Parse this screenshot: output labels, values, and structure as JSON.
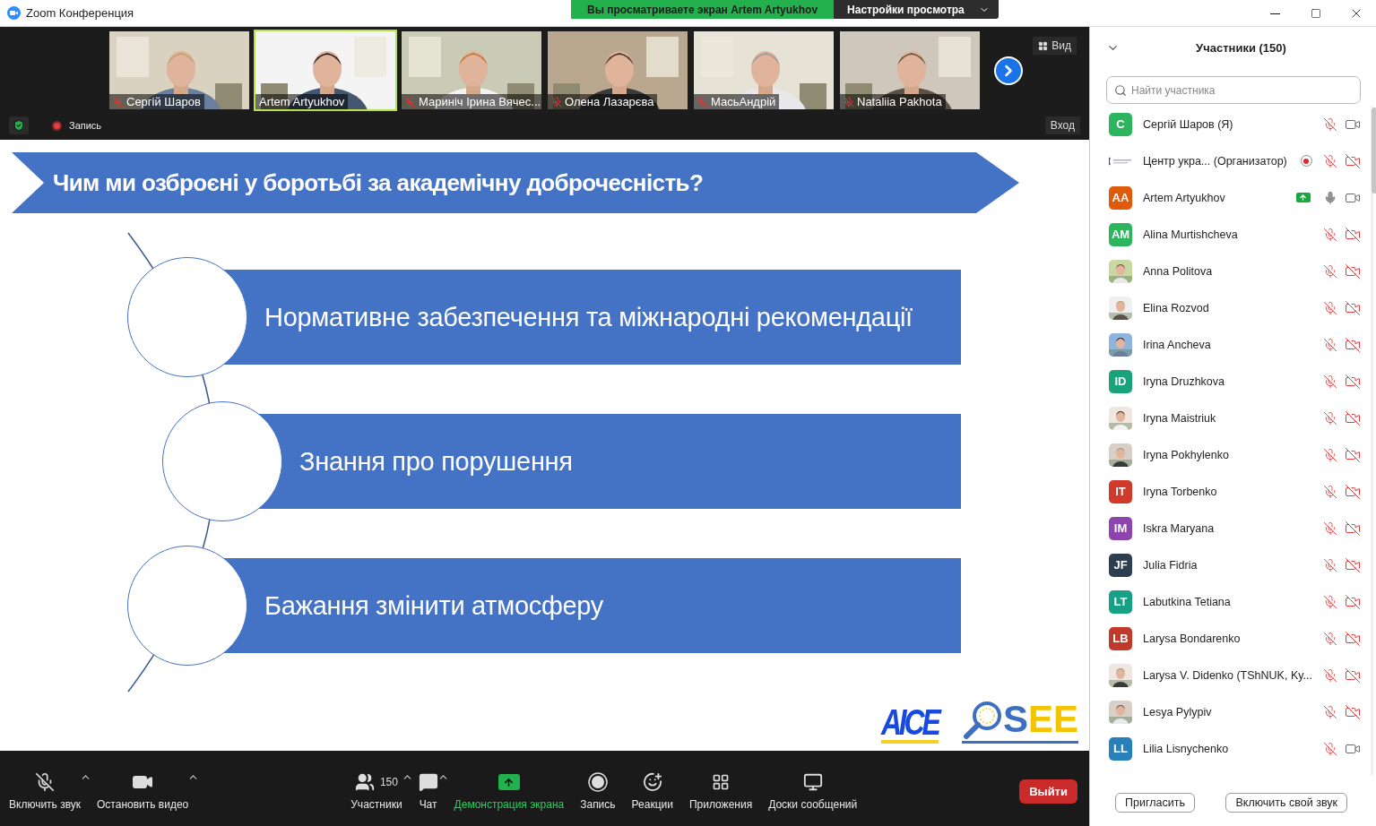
{
  "window": {
    "title": "Zoom Конференция"
  },
  "share_banner": {
    "text": "Вы просматриваете экран Artem Artyukhov",
    "settings_label": "Настройки просмотра"
  },
  "video_strip": {
    "tiles": [
      {
        "name": "Сергій Шаров",
        "muted": true,
        "highlighted": false
      },
      {
        "name": "Artem Artyukhov",
        "muted": false,
        "highlighted": true
      },
      {
        "name": "Мариніч Ірина Вячес...",
        "muted": true,
        "highlighted": false
      },
      {
        "name": "Олена Лазарєва",
        "muted": true,
        "highlighted": false
      },
      {
        "name": "МасьАндрій",
        "muted": true,
        "highlighted": false
      },
      {
        "name": "Nataliia Pakhota",
        "muted": true,
        "highlighted": false
      }
    ],
    "view_label": "Вид",
    "recording_label": "Запись",
    "enter_label": "Вход"
  },
  "slide": {
    "title": "Чим ми озброєні у боротьбі за академічну доброчесність?",
    "items": [
      "Нормативне забезпечення та міжнародні рекомендації",
      "Знання про порушення",
      "Бажання змінити атмосферу"
    ],
    "logos": [
      {
        "kind": "aice",
        "text": "AICE"
      },
      {
        "kind": "osee",
        "text": "SEE"
      }
    ]
  },
  "toolbar": {
    "items": [
      {
        "kind": "audio",
        "label": "Включить звук",
        "caret": true
      },
      {
        "kind": "video",
        "label": "Остановить видео",
        "caret": true
      },
      {
        "kind": "participants",
        "label": "Участники",
        "count": "150",
        "caret": true
      },
      {
        "kind": "chat",
        "label": "Чат",
        "caret": true
      },
      {
        "kind": "share",
        "label": "Демонстрация экрана",
        "caret": false
      },
      {
        "kind": "record",
        "label": "Запись",
        "caret": false
      },
      {
        "kind": "reactions",
        "label": "Реакции",
        "caret": false
      },
      {
        "kind": "apps",
        "label": "Приложения",
        "caret": false
      },
      {
        "kind": "boards",
        "label": "Доски сообщений",
        "caret": false
      }
    ],
    "leave_label": "Выйти"
  },
  "participants": {
    "title": "Участники (150)",
    "search": {
      "placeholder": "Найти участника"
    },
    "items": [
      {
        "name": "Сергій Шаров (Я)",
        "kind": "initials",
        "initials": "С",
        "color": "#2db55d",
        "recording": false,
        "sharing": false,
        "muted": true,
        "video_off": false
      },
      {
        "name": "Центр укра... (Организатор)",
        "kind": "logo",
        "recording": true,
        "sharing": false,
        "muted": true,
        "video_off": true
      },
      {
        "name": "Artem Artyukhov",
        "kind": "initials",
        "initials": "AA",
        "color": "#e05a0c",
        "recording": false,
        "sharing": true,
        "muted": false,
        "video_off": false
      },
      {
        "name": "Alina Murtishcheva",
        "kind": "initials",
        "initials": "AM",
        "color": "#2db55d",
        "recording": false,
        "sharing": false,
        "muted": true,
        "video_off": true
      },
      {
        "name": "Anna Politova",
        "recording": false,
        "sharing": false,
        "muted": true,
        "video_off": true
      },
      {
        "name": "Elina Rozvod",
        "recording": false,
        "sharing": false,
        "muted": true,
        "video_off": true
      },
      {
        "name": "Irina Ancheva",
        "recording": false,
        "sharing": false,
        "muted": true,
        "video_off": true
      },
      {
        "name": "Iryna Druzhkova",
        "kind": "initials",
        "initials": "ID",
        "color": "#1aa37a",
        "recording": false,
        "sharing": false,
        "muted": true,
        "video_off": true
      },
      {
        "name": "Iryna Maistriuk",
        "recording": false,
        "sharing": false,
        "muted": true,
        "video_off": true
      },
      {
        "name": "Iryna Pokhylenko",
        "recording": false,
        "sharing": false,
        "muted": true,
        "video_off": true
      },
      {
        "name": "Iryna Torbenko",
        "kind": "initials",
        "initials": "IT",
        "color": "#d13a2b",
        "recording": false,
        "sharing": false,
        "muted": true,
        "video_off": true
      },
      {
        "name": "Iskra Maryana",
        "kind": "initials",
        "initials": "IM",
        "color": "#8e44ad",
        "recording": false,
        "sharing": false,
        "muted": true,
        "video_off": true
      },
      {
        "name": "Julia Fidria",
        "kind": "initials",
        "initials": "JF",
        "color": "#2c3e50",
        "recording": false,
        "sharing": false,
        "muted": true,
        "video_off": true
      },
      {
        "name": "Labutkina Tetiana",
        "kind": "initials",
        "initials": "LT",
        "color": "#16a085",
        "recording": false,
        "sharing": false,
        "muted": true,
        "video_off": true
      },
      {
        "name": "Larysa Bondarenko",
        "kind": "initials",
        "initials": "LB",
        "color": "#c0392b",
        "recording": false,
        "sharing": false,
        "muted": true,
        "video_off": true
      },
      {
        "name": "Larysa V. Didenko (TShNUK, Ky...",
        "recording": false,
        "sharing": false,
        "muted": true,
        "video_off": true
      },
      {
        "name": "Lesya Pylypiv",
        "recording": false,
        "sharing": false,
        "muted": true,
        "video_off": true
      },
      {
        "name": "Lilia Lisnychenko",
        "kind": "initials",
        "initials": "LL",
        "color": "#2980b9",
        "recording": false,
        "sharing": false,
        "muted": true,
        "video_off": false
      }
    ],
    "buttons": [
      "Пригласить",
      "Включить свой звук"
    ]
  }
}
